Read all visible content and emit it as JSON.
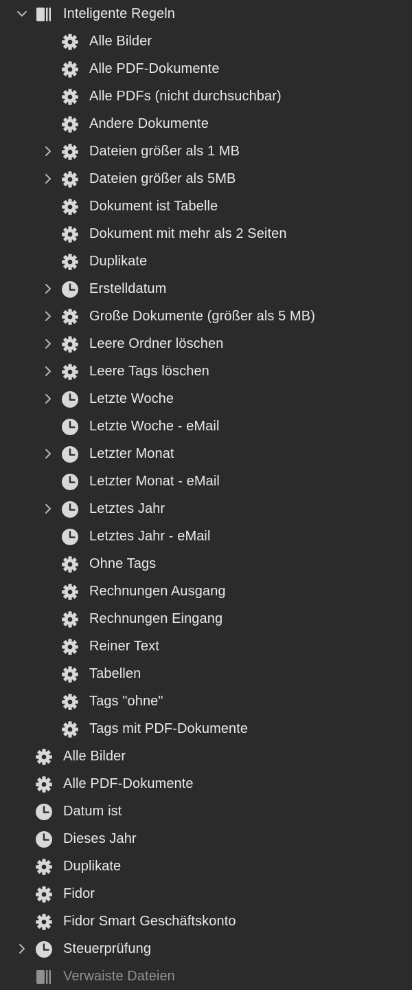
{
  "tree": {
    "groups": [
      {
        "label": "Inteligente Regeln",
        "icon": "rules-folder-icon",
        "expanded": true,
        "children": [
          {
            "label": "Alle Bilder",
            "icon": "gear-icon",
            "has_children": false
          },
          {
            "label": "Alle PDF-Dokumente",
            "icon": "gear-icon",
            "has_children": false
          },
          {
            "label": "Alle PDFs (nicht durchsuchbar)",
            "icon": "gear-icon",
            "has_children": false
          },
          {
            "label": "Andere Dokumente",
            "icon": "gear-icon",
            "has_children": false
          },
          {
            "label": "Dateien größer als 1 MB",
            "icon": "gear-icon",
            "has_children": true
          },
          {
            "label": "Dateien größer als 5MB",
            "icon": "gear-icon",
            "has_children": true
          },
          {
            "label": "Dokument ist Tabelle",
            "icon": "gear-icon",
            "has_children": false
          },
          {
            "label": "Dokument mit mehr als 2 Seiten",
            "icon": "gear-icon",
            "has_children": false
          },
          {
            "label": "Duplikate",
            "icon": "gear-icon",
            "has_children": false
          },
          {
            "label": "Erstelldatum",
            "icon": "clock-icon",
            "has_children": true
          },
          {
            "label": "Große Dokumente (größer als 5 MB)",
            "icon": "gear-icon",
            "has_children": true
          },
          {
            "label": "Leere Ordner löschen",
            "icon": "gear-icon",
            "has_children": true
          },
          {
            "label": "Leere Tags löschen",
            "icon": "gear-icon",
            "has_children": true
          },
          {
            "label": "Letzte Woche",
            "icon": "clock-icon",
            "has_children": true
          },
          {
            "label": "Letzte Woche - eMail",
            "icon": "clock-icon",
            "has_children": false
          },
          {
            "label": "Letzter Monat",
            "icon": "clock-icon",
            "has_children": true
          },
          {
            "label": "Letzter Monat - eMail",
            "icon": "clock-icon",
            "has_children": false
          },
          {
            "label": "Letztes Jahr",
            "icon": "clock-icon",
            "has_children": true
          },
          {
            "label": "Letztes Jahr - eMail",
            "icon": "clock-icon",
            "has_children": false
          },
          {
            "label": "Ohne Tags",
            "icon": "gear-icon",
            "has_children": false
          },
          {
            "label": "Rechnungen Ausgang",
            "icon": "gear-icon",
            "has_children": false
          },
          {
            "label": "Rechnungen Eingang",
            "icon": "gear-icon",
            "has_children": false
          },
          {
            "label": "Reiner Text",
            "icon": "gear-icon",
            "has_children": false
          },
          {
            "label": "Tabellen",
            "icon": "gear-icon",
            "has_children": false
          },
          {
            "label": "Tags \"ohne\"",
            "icon": "gear-icon",
            "has_children": false
          },
          {
            "label": "Tags mit PDF-Dokumente",
            "icon": "gear-icon",
            "has_children": false
          }
        ]
      }
    ],
    "top_items": [
      {
        "label": "Alle Bilder",
        "icon": "gear-icon",
        "has_children": false
      },
      {
        "label": "Alle PDF-Dokumente",
        "icon": "gear-icon",
        "has_children": false
      },
      {
        "label": "Datum ist",
        "icon": "clock-icon",
        "has_children": false
      },
      {
        "label": "Dieses Jahr",
        "icon": "clock-icon",
        "has_children": false
      },
      {
        "label": "Duplikate",
        "icon": "gear-icon",
        "has_children": false
      },
      {
        "label": "Fidor",
        "icon": "gear-icon",
        "has_children": false
      },
      {
        "label": "Fidor Smart Geschäftskonto",
        "icon": "gear-icon",
        "has_children": false
      },
      {
        "label": "Steuerprüfung",
        "icon": "clock-icon",
        "has_children": true
      },
      {
        "label": "Verwaiste Dateien",
        "icon": "rules-folder-icon",
        "has_children": false,
        "dimmed": true
      }
    ]
  },
  "colors": {
    "background": "#2b2b2b",
    "text": "#e9e9e9",
    "icon": "#d8d8d8",
    "chevron": "#b5b5b5",
    "dimmed_text": "#8f8f8f"
  }
}
